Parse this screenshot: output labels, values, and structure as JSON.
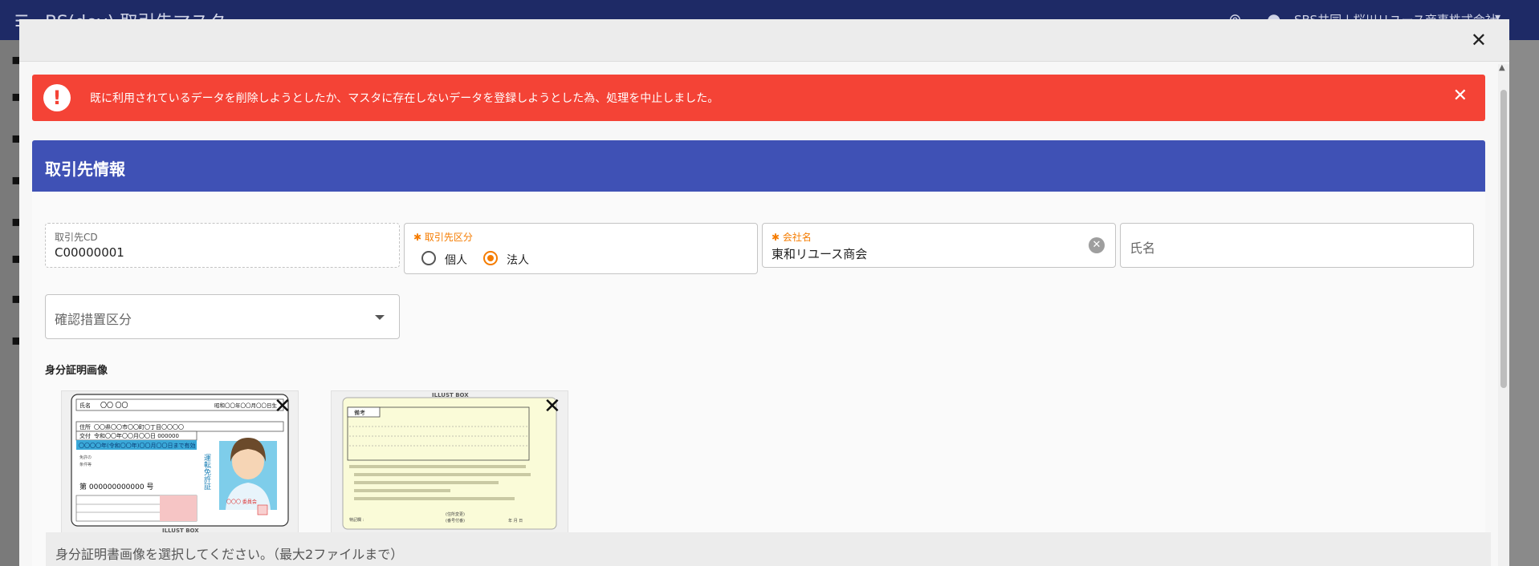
{
  "appbar": {
    "title": "BS(dev) 取引先マスタ",
    "company": "SBS共同 | 桜川リユース商事株式会社"
  },
  "alert": {
    "message": "既に利用されているデータを削除しようとしたか、マスタに存在しないデータを登録しようとした為、処理を中止しました。"
  },
  "card": {
    "title": "取引先情報"
  },
  "form": {
    "partner_cd": {
      "label": "取引先CD",
      "value": "C00000001"
    },
    "partner_type": {
      "label": "取引先区分",
      "options": [
        "個人",
        "法人"
      ],
      "selected": "法人"
    },
    "company_name": {
      "label": "会社名",
      "value": "東和リユース商会"
    },
    "person_name": {
      "placeholder": "氏名"
    },
    "confirm_method": {
      "placeholder": "確認措置区分"
    }
  },
  "id_images": {
    "heading": "身分証明画像",
    "card1": {
      "logo": "ILLUST BOX",
      "name_label": "氏名",
      "name_value": "〇〇 〇〇",
      "birth": "昭和〇〇年〇〇月〇〇日生",
      "addr_label": "住所",
      "addr_value": "〇〇県〇〇市〇〇町〇丁目〇〇〇〇",
      "issue_label": "交付",
      "issue_value": "令和〇〇年〇〇月〇〇日 000000",
      "valid_value": "〇〇〇〇年(令和〇〇年)〇〇月〇〇日まで有効",
      "number": "第 000000000000 号",
      "side_text": "運転免許証",
      "seal": "〇〇〇 委員会"
    },
    "card2": {
      "logo": "ILLUST BOX",
      "remarks_label": "備考",
      "foot1": "(住所変更)",
      "foot2": "(番号付番)",
      "foot3": "年 月 日",
      "foot4": "特記欄 :"
    }
  },
  "upload": {
    "placeholder": "身分証明書画像を選択してください。（最大2ファイルまで）"
  }
}
